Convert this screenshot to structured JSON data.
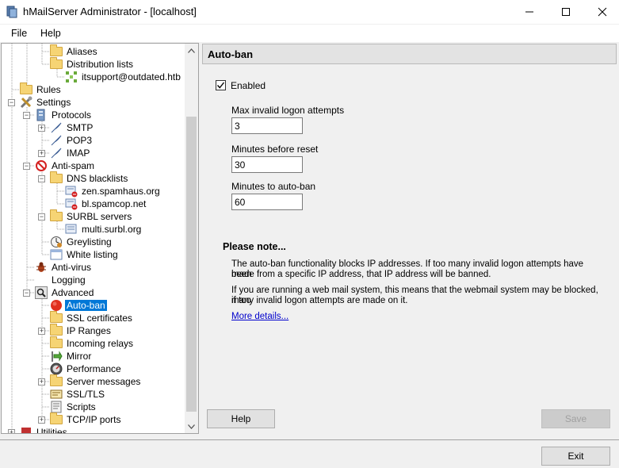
{
  "window": {
    "title": "hMailServer Administrator - [localhost]"
  },
  "menu": {
    "file": "File",
    "help": "Help"
  },
  "tree": {
    "items": [
      {
        "label": "Aliases",
        "icon": "folder-icon"
      },
      {
        "label": "Distribution lists",
        "icon": "folder-icon"
      },
      {
        "label": "itsupport@outdated.htb",
        "icon": "distribution-list-icon"
      },
      {
        "label": "Rules",
        "icon": "folder-icon"
      },
      {
        "label": "Settings",
        "icon": "tools-icon"
      },
      {
        "label": "Protocols",
        "icon": "protocols-icon"
      },
      {
        "label": "SMTP",
        "icon": "feather-icon"
      },
      {
        "label": "POP3",
        "icon": "feather-icon"
      },
      {
        "label": "IMAP",
        "icon": "feather-icon"
      },
      {
        "label": "Anti-spam",
        "icon": "no-entry-icon"
      },
      {
        "label": "DNS blacklists",
        "icon": "folder-icon"
      },
      {
        "label": "zen.spamhaus.org",
        "icon": "server-blocked-icon"
      },
      {
        "label": "bl.spamcop.net",
        "icon": "server-blocked-icon"
      },
      {
        "label": "SURBL servers",
        "icon": "folder-icon"
      },
      {
        "label": "multi.surbl.org",
        "icon": "server-icon"
      },
      {
        "label": "Greylisting",
        "icon": "clock-icon"
      },
      {
        "label": "White listing",
        "icon": "window-icon"
      },
      {
        "label": "Anti-virus",
        "icon": "bug-icon"
      },
      {
        "label": "Logging",
        "icon": "blank-icon"
      },
      {
        "label": "Advanced",
        "icon": "magnifier-icon"
      },
      {
        "label": "Auto-ban",
        "icon": "red-circle-icon"
      },
      {
        "label": "SSL certificates",
        "icon": "folder-icon"
      },
      {
        "label": "IP Ranges",
        "icon": "folder-icon"
      },
      {
        "label": "Incoming relays",
        "icon": "folder-icon"
      },
      {
        "label": "Mirror",
        "icon": "mirror-icon"
      },
      {
        "label": "Performance",
        "icon": "gauge-icon"
      },
      {
        "label": "Server messages",
        "icon": "folder-icon"
      },
      {
        "label": "SSL/TLS",
        "icon": "certificate-icon"
      },
      {
        "label": "Scripts",
        "icon": "script-icon"
      },
      {
        "label": "TCP/IP ports",
        "icon": "folder-icon"
      },
      {
        "label": "Utilities",
        "icon": "utilities-icon"
      }
    ],
    "selected": "Auto-ban"
  },
  "panel": {
    "title": "Auto-ban",
    "enabled_label": "Enabled",
    "enabled_checked": true,
    "max_attempts_label": "Max invalid logon attempts",
    "max_attempts_value": "3",
    "minutes_reset_label": "Minutes before reset",
    "minutes_reset_value": "30",
    "minutes_ban_label": "Minutes to auto-ban",
    "minutes_ban_value": "60",
    "note_title": "Please note...",
    "note_line1": "The auto-ban functionality blocks IP addresses. If too many invalid logon attempts have been",
    "note_line2": "made from a specific IP address, that IP address will be banned.",
    "note_line3": "If you are running a web mail system, this means that the webmail system may be blocked, if too",
    "note_line4": "many invalid logon attempts are made on it.",
    "more_details": "More details...",
    "help_button": "Help",
    "save_button": "Save"
  },
  "footer": {
    "exit_button": "Exit"
  },
  "colors": {
    "selection": "#0078d7",
    "link": "#0000cc",
    "folder": "#f6d474"
  }
}
